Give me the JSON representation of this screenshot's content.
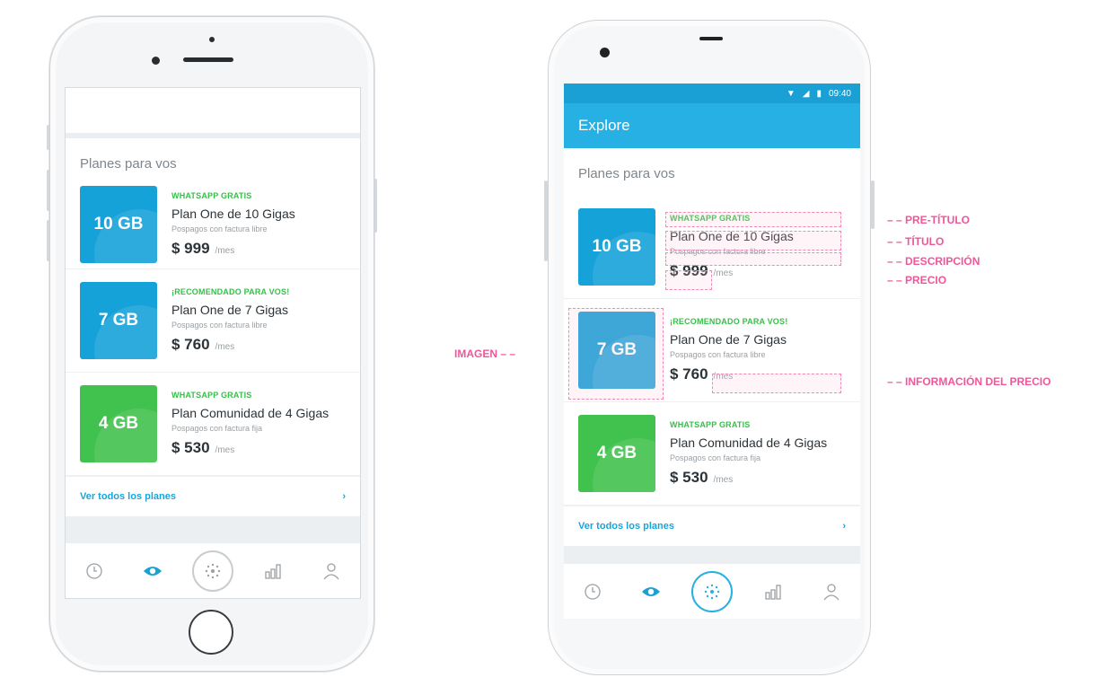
{
  "android_status": {
    "time": "09:40"
  },
  "android_appbar": {
    "title": "Explore"
  },
  "section": {
    "title": "Planes para vos",
    "see_all": "Ver todos los planes",
    "see_all_chevron": "›"
  },
  "plans": [
    {
      "tile": "10 GB",
      "tile_color": "#15a2d8",
      "pretitle": "WHATSAPP GRATIS",
      "title": "Plan One de 10 Gigas",
      "description": "Pospagos con factura libre",
      "price": "$ 999",
      "period": "/mes"
    },
    {
      "tile": "7 GB",
      "tile_color": "#15a2d8",
      "pretitle": "¡RECOMENDADO PARA VOS!",
      "title": "Plan One de 7 Gigas",
      "description": "Pospagos con factura libre",
      "price": "$ 760",
      "period": "/mes"
    },
    {
      "tile": "4 GB",
      "tile_color": "#41c14d",
      "pretitle": "WHATSAPP GRATIS",
      "title": "Plan Comunidad de 4 Gigas",
      "description": "Pospagos con factura fija",
      "price": "$ 530",
      "period": "/mes"
    }
  ],
  "annotations": {
    "pretitle": "– – PRE-TÍTULO",
    "title": "– – TÍTULO",
    "description": "– – DESCRIPCIÓN",
    "price": "– – PRECIO",
    "image": "IMAGEN – –",
    "price_info": "– – INFORMACIÓN DEL PRECIO"
  },
  "tabs": [
    {
      "icon": "clock-icon"
    },
    {
      "icon": "eye-icon"
    },
    {
      "icon": "dots-hub-icon"
    },
    {
      "icon": "bar-chart-icon"
    },
    {
      "icon": "user-icon"
    }
  ],
  "colors": {
    "accent": "#26b0e3",
    "green": "#41c14d",
    "annotation": "#f0569a"
  }
}
